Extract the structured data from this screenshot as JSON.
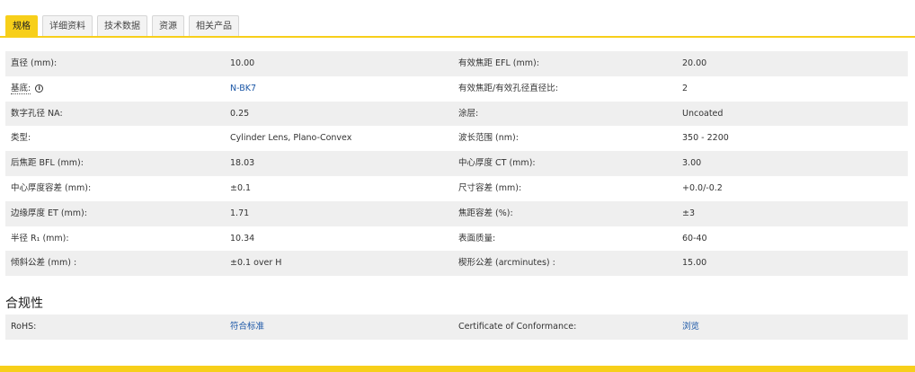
{
  "tabs": [
    {
      "label": "规格"
    },
    {
      "label": "详细资料"
    },
    {
      "label": "技术数据"
    },
    {
      "label": "资源"
    },
    {
      "label": "相关产品"
    }
  ],
  "specs": [
    {
      "l1": "直径 (mm):",
      "v1": "10.00",
      "l2": "有效焦距 EFL (mm):",
      "v2": "20.00"
    },
    {
      "l1": "基底:",
      "v1": "N-BK7",
      "l2": "有效焦距/有效孔径直径比:",
      "v2": "2"
    },
    {
      "l1": "数字孔径 NA:",
      "v1": "0.25",
      "l2": "涂层:",
      "v2": "Uncoated"
    },
    {
      "l1": "类型:",
      "v1": "Cylinder Lens, Plano-Convex",
      "l2": "波长范围 (nm):",
      "v2": "350 - 2200"
    },
    {
      "l1": "后焦距 BFL (mm):",
      "v1": "18.03",
      "l2": "中心厚度 CT (mm):",
      "v2": "3.00"
    },
    {
      "l1": "中心厚度容差 (mm):",
      "v1": "±0.1",
      "l2": "尺寸容差 (mm):",
      "v2": "+0.0/-0.2"
    },
    {
      "l1": "边缘厚度 ET (mm):",
      "v1": "1.71",
      "l2": "焦距容差 (%):",
      "v2": "±3"
    },
    {
      "l1": "半径 R₁ (mm):",
      "v1": "10.34",
      "l2": "表面质量:",
      "v2": "60-40"
    },
    {
      "l1": "倾斜公差 (mm) :",
      "v1": "±0.1 over H",
      "l2": "楔形公差 (arcminutes) :",
      "v2": "15.00"
    }
  ],
  "info_icon": "info-icon",
  "compliance": {
    "title": "合规性",
    "rows": [
      {
        "l1": "RoHS:",
        "v1": "符合标准",
        "l2": "Certificate of Conformance:",
        "v2": "浏览"
      }
    ]
  },
  "colors": {
    "accent": "#f7cf1a",
    "link": "#1a56a6",
    "row_alt": "#efefef"
  }
}
